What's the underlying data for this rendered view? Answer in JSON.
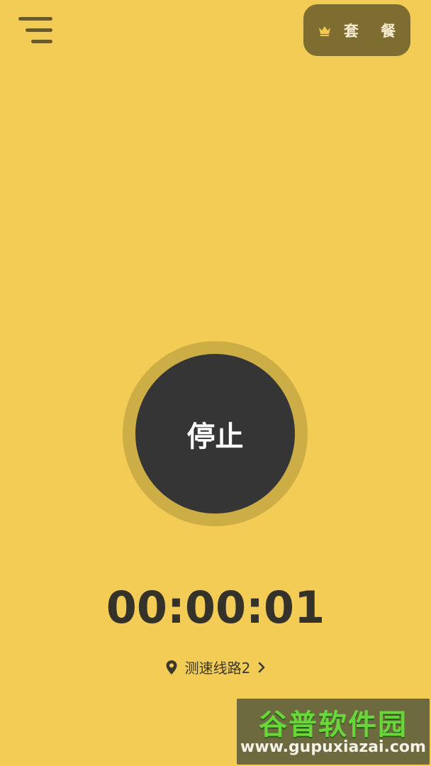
{
  "header": {
    "menu_icon": "hamburger-menu-icon",
    "plan_button": {
      "icon": "crown-icon",
      "label": "套 餐"
    }
  },
  "main": {
    "stop_button_label": "停止",
    "timer": "00:00:01",
    "route": {
      "icon": "location-pin-icon",
      "label": "测速线路2",
      "chevron": "chevron-right-icon"
    }
  },
  "watermark": {
    "title": "谷普软件园",
    "url": "www.gupuxiazai.com"
  },
  "colors": {
    "background": "#f2cc55",
    "plan_button_bg": "#7d6d30",
    "ring": "#cdae46",
    "stop_button": "#353535",
    "text_dark": "#35322a",
    "crown": "#f2c94c"
  }
}
